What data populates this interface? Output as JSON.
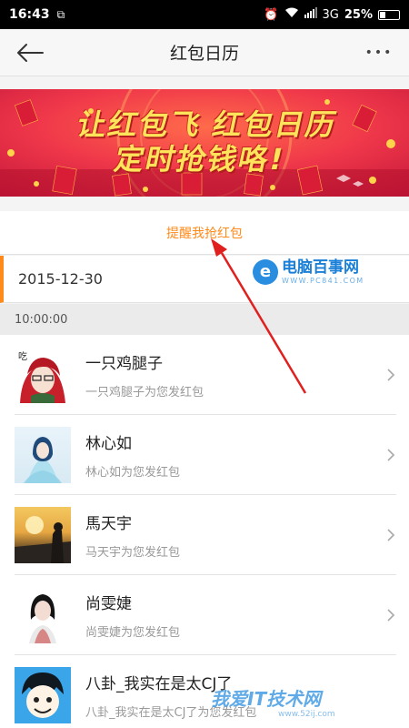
{
  "status_bar": {
    "time": "16:43",
    "network": "3G",
    "battery": "25%"
  },
  "nav": {
    "title": "红包日历",
    "back_icon": "arrow-left-icon",
    "more_icon": "more-dots-icon",
    "more_glyph": "•••"
  },
  "banner": {
    "line1": "让红包飞 红包日历",
    "line2": "定时抢钱咯!"
  },
  "remind_label": "提醒我抢红包",
  "date": "2015-12-30",
  "time_header": "10:00:00",
  "watermark": {
    "title": "电脑百事网",
    "url": "WWW.PC841.COM"
  },
  "bottom_watermark": {
    "title": "我爱IT技术网",
    "url": "www.52ij.com"
  },
  "items": [
    {
      "name": "一只鸡腿子",
      "sub": "一只鸡腿子为您发红包"
    },
    {
      "name": "林心如",
      "sub": "林心如为您发红包"
    },
    {
      "name": "馬天宇",
      "sub": "马天宇为您发红包"
    },
    {
      "name": "尚雯婕",
      "sub": "尚雯婕为您发红包"
    },
    {
      "name": "八卦_我实在是太CJ了",
      "sub": "八卦_我实在是太CJ了为您发红包"
    }
  ],
  "colors": {
    "accent": "#ff8a1a",
    "arrow": "#e0201e",
    "banner_bg": "#e8283a"
  }
}
